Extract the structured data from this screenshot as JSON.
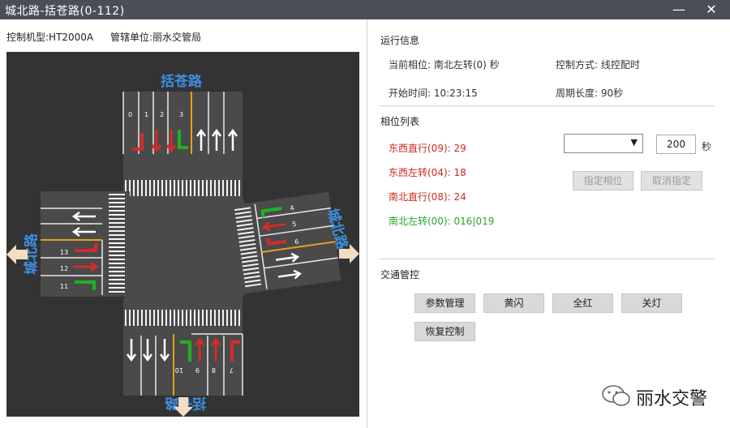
{
  "window": {
    "title": "城北路-括苍路(0-112)",
    "minimize": "—",
    "close": "✕"
  },
  "header": {
    "control_model": "控制机型:HT2000A",
    "management_unit": "管辖单位:丽水交管局"
  },
  "map": {
    "road_north_south": "括苍路",
    "road_east_west": "城北路",
    "north_lane_numbers": [
      "0",
      "1",
      "2",
      "3"
    ],
    "east_lane_numbers": [
      "4",
      "5",
      "6"
    ],
    "west_lane_numbers": [
      "13",
      "12",
      "11"
    ],
    "south_lane_numbers": [
      "10",
      "9",
      "8",
      "7"
    ]
  },
  "run_info": {
    "section_title": "运行信息",
    "current_phase": "当前相位: 南北左转(0)  秒",
    "control_mode": "控制方式: 线控配时",
    "start_time": "开始时间: 10:23:15",
    "cycle_length": "周期长度: 90秒"
  },
  "phase_list": {
    "section_title": "相位列表",
    "items": [
      {
        "text": "东西直行(09): 29",
        "color": "#cc2a1f"
      },
      {
        "text": "东西左转(04): 18",
        "color": "#cc2a1f"
      },
      {
        "text": "南北直行(08): 24",
        "color": "#cc2a1f"
      },
      {
        "text": "南北左转(00): 016|019",
        "color": "#2aa52a"
      }
    ],
    "select_value": "",
    "seconds_value": "200",
    "seconds_unit": "秒",
    "assign_phase_button": "指定相位",
    "cancel_assign_button": "取消指定"
  },
  "traffic_control": {
    "section_title": "交通管控",
    "buttons": [
      "参数管理",
      "黄闪",
      "全红",
      "关灯",
      "恢复控制"
    ]
  },
  "watermark": {
    "text": "丽水交警"
  },
  "colors": {
    "map_background": "#333333",
    "road": "#4a4a4a",
    "lane_red": "#d32b2b",
    "lane_green": "#22b022",
    "road_label": "#3d8fe0",
    "center_line": "#e8a21a"
  }
}
